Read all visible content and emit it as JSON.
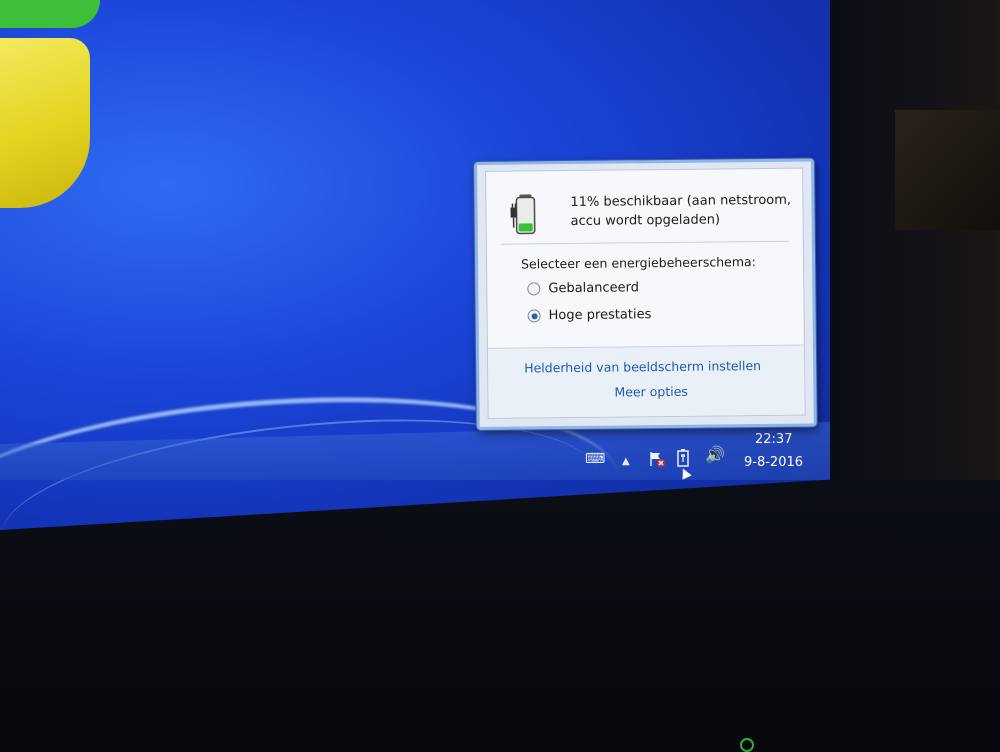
{
  "battery_flyout": {
    "status_line1": "11% beschikbaar (aan netstroom,",
    "status_line2": "accu wordt opgeladen)",
    "plan_prompt": "Selecteer een energiebeheerschema:",
    "plans": [
      {
        "label": "Gebalanceerd",
        "selected": false
      },
      {
        "label": "Hoge prestaties",
        "selected": true
      }
    ],
    "brightness_link": "Helderheid van beeldscherm instellen",
    "more_options_link": "Meer opties"
  },
  "taskbar": {
    "tray_icons": [
      "keyboard-icon",
      "show-hidden-icons-chevron",
      "action-center-flag-icon",
      "battery-power-icon",
      "volume-icon"
    ],
    "clock_time": "22:37",
    "clock_date": "9-8-2016"
  },
  "colors": {
    "desktop_blue": "#1b45d8",
    "link_blue": "#1f5ab5",
    "battery_green": "#3dbf3a"
  }
}
